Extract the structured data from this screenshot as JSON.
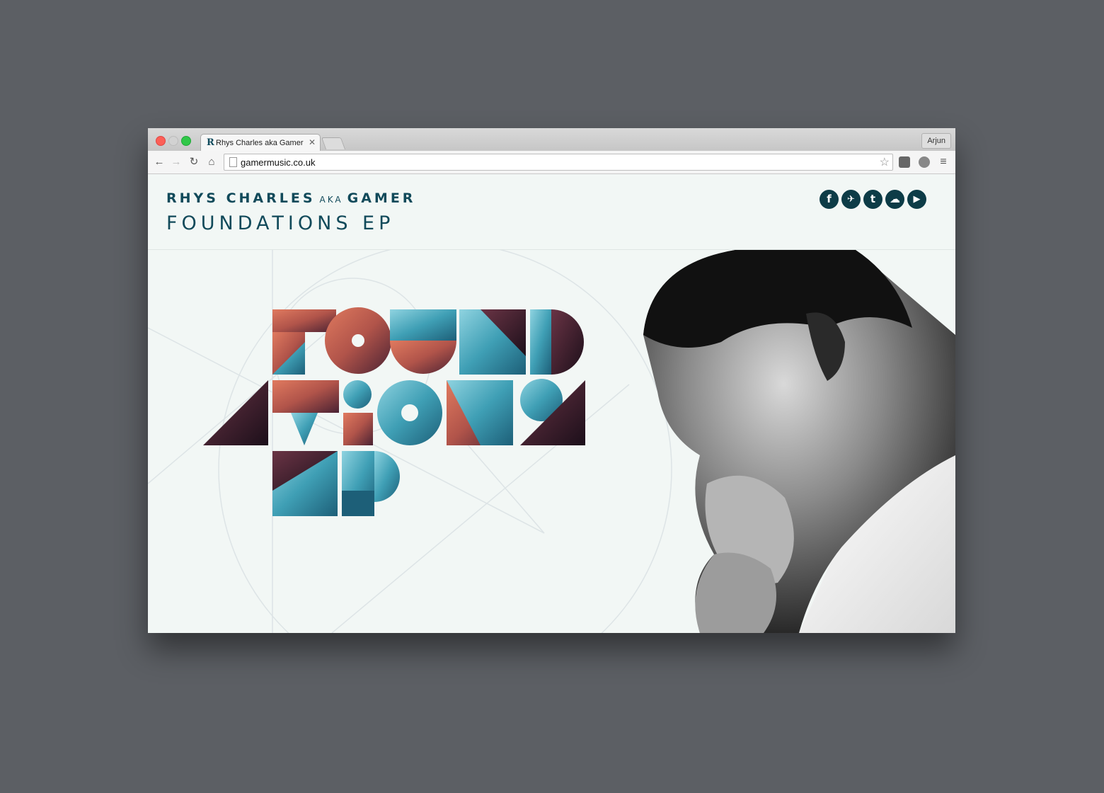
{
  "browser": {
    "tab_title": "Rhys Charles aka Gamer",
    "tab_favicon": "R",
    "profile_name": "Arjun",
    "url": "gamermusic.co.uk",
    "icons": [
      "back-icon",
      "forward-icon",
      "reload-icon",
      "home-icon",
      "star-icon",
      "pocket-icon",
      "extension-icon",
      "menu-icon"
    ]
  },
  "site": {
    "artist_name": "RHYS CHARLES",
    "aka": "AKA",
    "alias": "GAMER",
    "release_title": "FOUNDATIONS EP",
    "socials": [
      {
        "name": "facebook",
        "glyph": "f"
      },
      {
        "name": "twitter",
        "glyph": "🐦"
      },
      {
        "name": "tumblr",
        "glyph": "t"
      },
      {
        "name": "soundcloud",
        "glyph": "☁"
      },
      {
        "name": "youtube",
        "glyph": "▶"
      }
    ],
    "hero_logo_lines": [
      "FOUND",
      "ATIONS",
      "EP"
    ],
    "colors": {
      "brand": "#114a5a",
      "social_bg": "#0d3c47",
      "page_bg": "#f2f7f5",
      "nebula_red": "#c9624c",
      "ocean_teal": "#3f9fb5",
      "deep_space": "#3a1e2e"
    }
  }
}
